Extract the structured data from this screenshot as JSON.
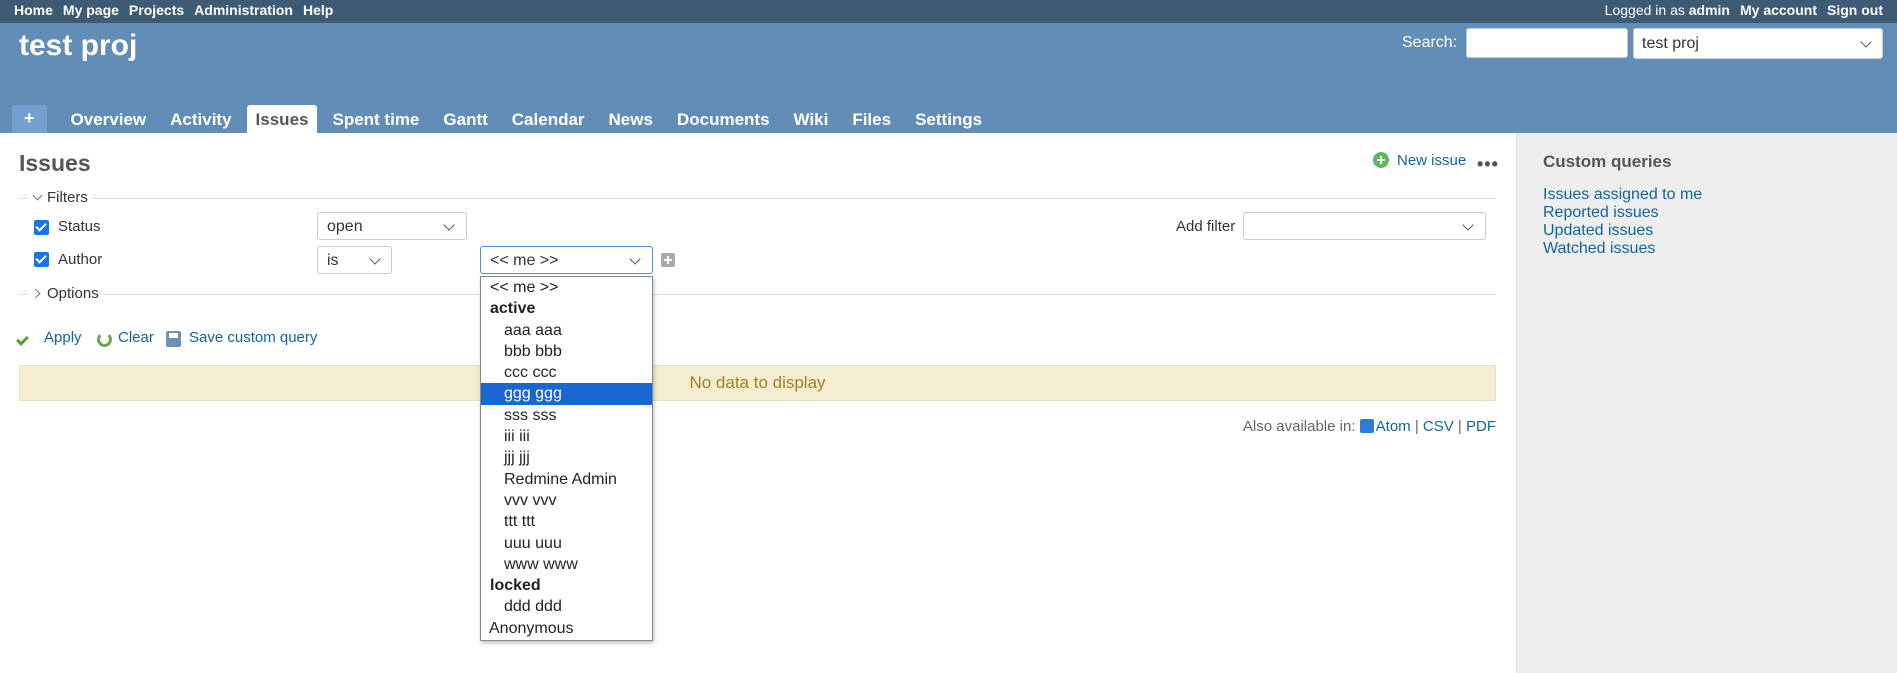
{
  "top_menu": {
    "links": [
      "Home",
      "My page",
      "Projects",
      "Administration",
      "Help"
    ],
    "logged_prefix": "Logged in as",
    "user": "admin",
    "my_account": "My account",
    "sign_out": "Sign out"
  },
  "header": {
    "project_title": "test proj",
    "search_label": "Search:",
    "search_value": "",
    "project_jump": "test proj"
  },
  "main_menu": {
    "plus": "+",
    "tabs": [
      "Overview",
      "Activity",
      "Issues",
      "Spent time",
      "Gantt",
      "Calendar",
      "News",
      "Documents",
      "Wiki",
      "Files",
      "Settings"
    ],
    "selected": "Issues"
  },
  "content": {
    "title": "Issues",
    "new_issue": "New issue",
    "more": "•••",
    "filters_legend": "Filters",
    "options_legend": "Options",
    "filters": {
      "status_label": "Status",
      "status_op": "open",
      "author_label": "Author",
      "author_op": "is",
      "author_value": "<< me >>",
      "add_filter_label": "Add filter",
      "add_filter_value": ""
    },
    "actions": {
      "apply": "Apply",
      "clear": "Clear",
      "save": "Save custom query"
    },
    "no_data": "No data to display",
    "also_available": "Also available in:",
    "formats": [
      "Atom",
      "CSV",
      "PDF"
    ]
  },
  "dropdown": {
    "top_option": "<< me >>",
    "group_active": "active",
    "active_users": [
      "aaa aaa",
      "bbb bbb",
      "ccc ccc",
      "ggg ggg",
      "sss sss",
      "iii iii",
      "jjj jjj",
      "Redmine Admin",
      "vvv vvv",
      "ttt ttt",
      "uuu uuu",
      "www www"
    ],
    "highlighted": "ggg ggg",
    "group_locked": "locked",
    "locked_users": [
      "ddd ddd"
    ],
    "anonymous": "Anonymous"
  },
  "sidebar": {
    "title": "Custom queries",
    "queries": [
      "Issues assigned to me",
      "Reported issues",
      "Updated issues",
      "Watched issues"
    ]
  },
  "colors": {
    "top_bar": "#3e5b76",
    "header": "#628db6",
    "link": "#116699",
    "highlight": "#1a66d2",
    "flash_bg": "#f3edd1"
  }
}
